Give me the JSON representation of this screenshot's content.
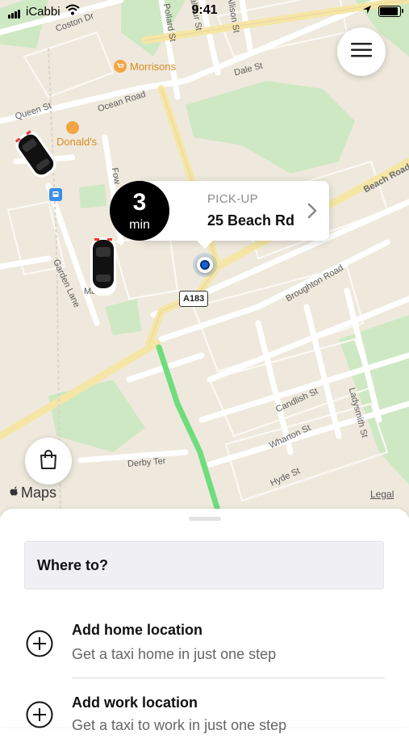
{
  "status_bar": {
    "carrier": "iCabbi",
    "time": "9:41"
  },
  "map": {
    "streets": [
      "Coston Dr",
      "Pollard St",
      "Balfour St",
      "Allison St",
      "Dale St",
      "Ocean Road",
      "Queen St",
      "Beach Road",
      "Broughton Road",
      "Garden Lane",
      "Candlish St",
      "Wharton St",
      "Ladysmith St",
      "Hyde St",
      "Derby Ter",
      "Fow",
      "Ma"
    ],
    "road_badge": "A183",
    "pois": [
      "Morrisons",
      "Donald's"
    ],
    "attribution": "Maps",
    "legal": "Legal"
  },
  "pickup": {
    "eta_value": "3",
    "eta_unit": "min",
    "label": "PICK-UP",
    "address": "25 Beach Rd"
  },
  "sheet": {
    "search_placeholder": "Where to?",
    "items": [
      {
        "title": "Add home location",
        "subtitle": "Get a taxi home in just one step"
      },
      {
        "title": "Add work location",
        "subtitle": "Get a taxi to work in just one step"
      }
    ]
  },
  "icons": [
    "menu-icon",
    "shopping-bag-icon",
    "chevron-right-icon",
    "location-dot-icon",
    "plus-circle-icon",
    "car-icon",
    "apple-icon",
    "bus-stop-icon",
    "cart-icon",
    "wifi-icon",
    "signal-icon",
    "battery-icon",
    "location-arrow-icon"
  ],
  "colors": {
    "route": "#6fdc7e",
    "park": "#cfe8c4",
    "road_major": "#f6e6a6",
    "map_bg": "#efe9dd",
    "location_dot": "#1463d6"
  }
}
